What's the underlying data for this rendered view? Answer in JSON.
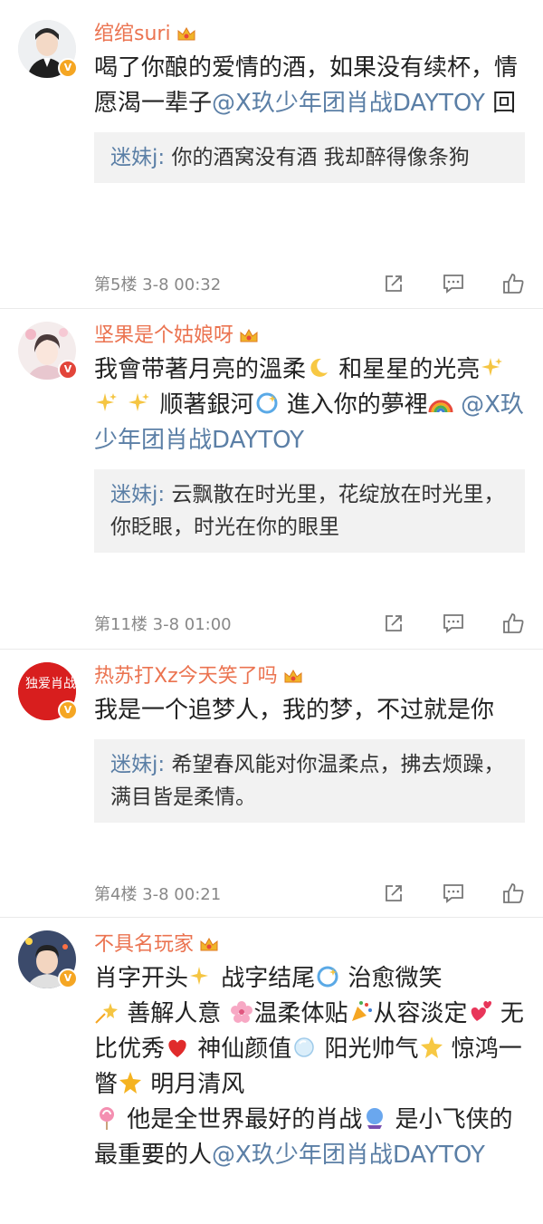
{
  "comments": [
    {
      "username": "绾绾suri",
      "text_parts": [
        "喝了你酿的爱情的酒，如果没有续杯，情愿渴一辈子",
        "@X玖少年团肖战DAYTOY",
        " 回"
      ],
      "reply_user": "迷妹j:",
      "reply_text": " 你的酒窝没有酒 我却醉得像条狗",
      "meta": "第5楼  3-8 00:32"
    },
    {
      "username": "坚果是个姑娘呀",
      "text_parts": [
        "我會带著月亮的溫柔",
        " 和星星的光亮",
        " 顺著銀河",
        " 進入你的夢裡",
        " ",
        "@X玖少年团肖战DAYTOY"
      ],
      "reply_user": "迷妹j:",
      "reply_text": " 云飘散在时光里，花绽放在时光里，你眨眼，时光在你的眼里",
      "meta": "第11楼  3-8 01:00"
    },
    {
      "username": "热苏打Xz今天笑了吗",
      "text_parts": [
        "我是一个追梦人，我的梦，不过就是你"
      ],
      "reply_user": "迷妹j:",
      "reply_text": " 希望春风能对你温柔点，拂去烦躁，满目皆是柔情。",
      "meta": "第4楼  3-8 00:21"
    },
    {
      "username": "不具名玩家",
      "text_parts": [
        "肖字开头",
        " 战字结尾",
        " 治愈微笑",
        " 善解人意 ",
        "温柔体贴",
        "从容淡定",
        " 无比优秀",
        " 神仙颜值",
        " 阳光帅气",
        " 惊鸿一瞥",
        " 明月清风",
        " 他是全世界最好的肖战",
        " 是小飞侠的最重要的人",
        "@X玖少年团肖战DAYTOY"
      ]
    }
  ],
  "avatar3_text": "独爱肖战",
  "colors": {
    "username": "#eb7350",
    "mention": "#5b7fa6",
    "reply_bg": "#f2f2f2",
    "vip_badge": "#f5a623"
  },
  "icons": [
    "crown-icon",
    "verified-badge-icon",
    "share-icon",
    "comment-icon",
    "like-icon"
  ]
}
